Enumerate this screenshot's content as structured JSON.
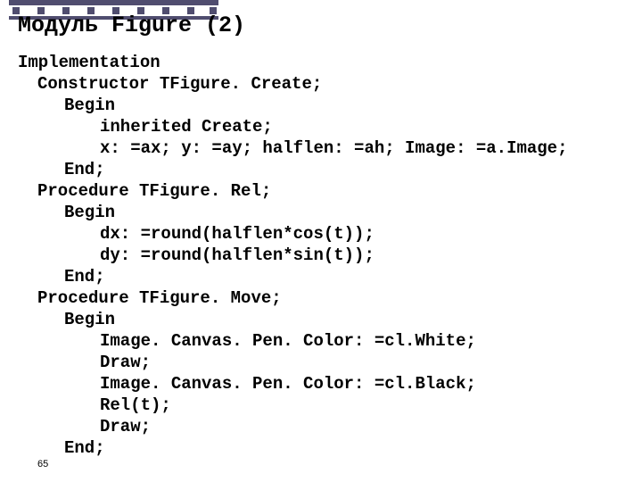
{
  "title": "Модуль Figure (2)",
  "lines": {
    "l01": "Implementation",
    "l02": "Constructor TFigure. Create;",
    "l03": "Begin",
    "l04": "inherited Create;",
    "l05": "x: =ax; y: =ay; halflen: =ah; Image: =a.Image;",
    "l06": "End;",
    "l07": "Procedure TFigure. Rel;",
    "l08": "Begin",
    "l09": "dx: =round(halflen*cos(t));",
    "l10": "dy: =round(halflen*sin(t));",
    "l11": "End;",
    "l12": "Procedure TFigure. Move;",
    "l13": "Begin",
    "l14": "Image. Canvas. Pen. Color: =cl.White;",
    "l15": "Draw;",
    "l16": "Image. Canvas. Pen. Color: =cl.Black;",
    "l17": "Rel(t);",
    "l18": "Draw;",
    "l19": "End;"
  },
  "page_number": "65"
}
